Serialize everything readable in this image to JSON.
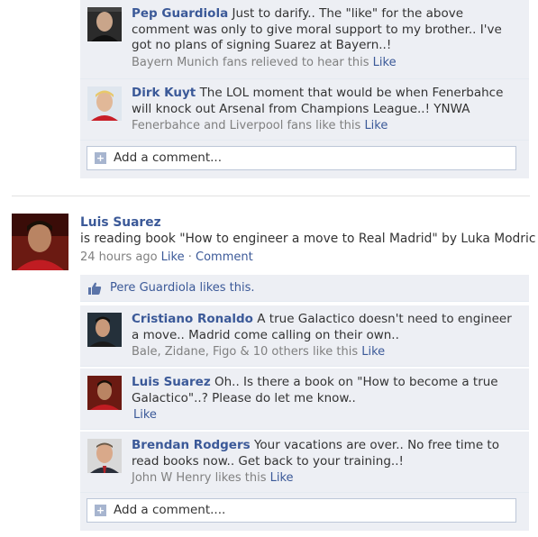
{
  "top_comments": [
    {
      "author": "Pep Guardiola",
      "text": "Just to darify.. The \"like\" for the above comment was only to give moral support to my brother.. I've got no plans of signing Suarez at Bayern..!",
      "meta": "Bayern Munich fans relieved to hear this",
      "like": "Like",
      "avatar": "avatar-pep-guardiola"
    },
    {
      "author": "Dirk Kuyt",
      "text": "The LOL moment that would be when Fenerbahce will knock out Arsenal from Champions League..! YNWA",
      "meta": "Fenerbahce and Liverpool fans like this",
      "like": "Like",
      "avatar": "avatar-dirk-kuyt"
    }
  ],
  "add_comment_1": "Add a comment...",
  "post": {
    "author": "Luis Suarez",
    "status": "is reading book \"How to engineer a move to Real Madrid\" by Luka Modric",
    "time": "24 hours ago",
    "like": "Like",
    "separator": "·",
    "comment": "Comment"
  },
  "post_likes": "Pere Guardiola likes this.",
  "bottom_comments": [
    {
      "author": "Cristiano Ronaldo",
      "text": "A true Galactico doesn't need to engineer a move.. Madrid come calling on their own..",
      "meta": "Bale, Zidane, Figo & 10 others like this",
      "like": "Like",
      "avatar": "avatar-cristiano-ronaldo"
    },
    {
      "author": "Luis Suarez",
      "text": "Oh.. Is there a book on \"How to become a true Galactico\"..? Please do let me know..",
      "meta": "",
      "like": "Like",
      "avatar": "avatar-luis-suarez-small"
    },
    {
      "author": "Brendan Rodgers",
      "text": "Your vacations are over.. No free time to read books now.. Get back to your training..!",
      "meta": "John W Henry likes this",
      "like": "Like",
      "avatar": "avatar-brendan-rodgers"
    }
  ],
  "add_comment_2": "Add a comment....",
  "colors": {
    "link": "#3b5998",
    "panel": "#edeff4",
    "meta": "#808080"
  }
}
